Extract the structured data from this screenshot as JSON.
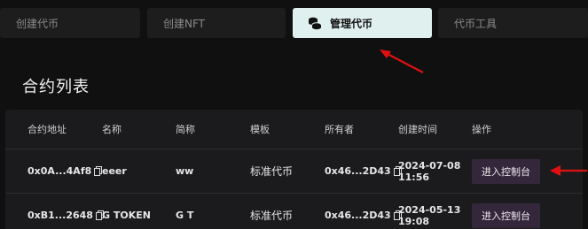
{
  "tabs": [
    {
      "label": "创建代币",
      "active": false
    },
    {
      "label": "创建NFT",
      "active": false
    },
    {
      "label": "管理代币",
      "active": true,
      "icon": "coins-icon"
    },
    {
      "label": "代币工具",
      "active": false
    }
  ],
  "section_title": "合约列表",
  "table": {
    "headers": [
      "合约地址",
      "名称",
      "简称",
      "模板",
      "所有者",
      "创建时间",
      "操作"
    ],
    "rows": [
      {
        "address": "0x0A...4Af8",
        "name": "eeer",
        "symbol": "ww",
        "template": "标准代币",
        "owner": "0x46...2D43",
        "date": "2024-07-08",
        "time": "11:56",
        "action": "进入控制台"
      },
      {
        "address": "0xB1...2648",
        "name": "G TOKEN",
        "symbol": "G T",
        "template": "标准代币",
        "owner": "0x46...2D43",
        "date": "2024-05-13",
        "time": "19:08",
        "action": "进入控制台"
      }
    ]
  },
  "colors": {
    "accent_tab": "#dff0ee",
    "button": "#35273b",
    "annotation_arrow": "#e01010"
  }
}
